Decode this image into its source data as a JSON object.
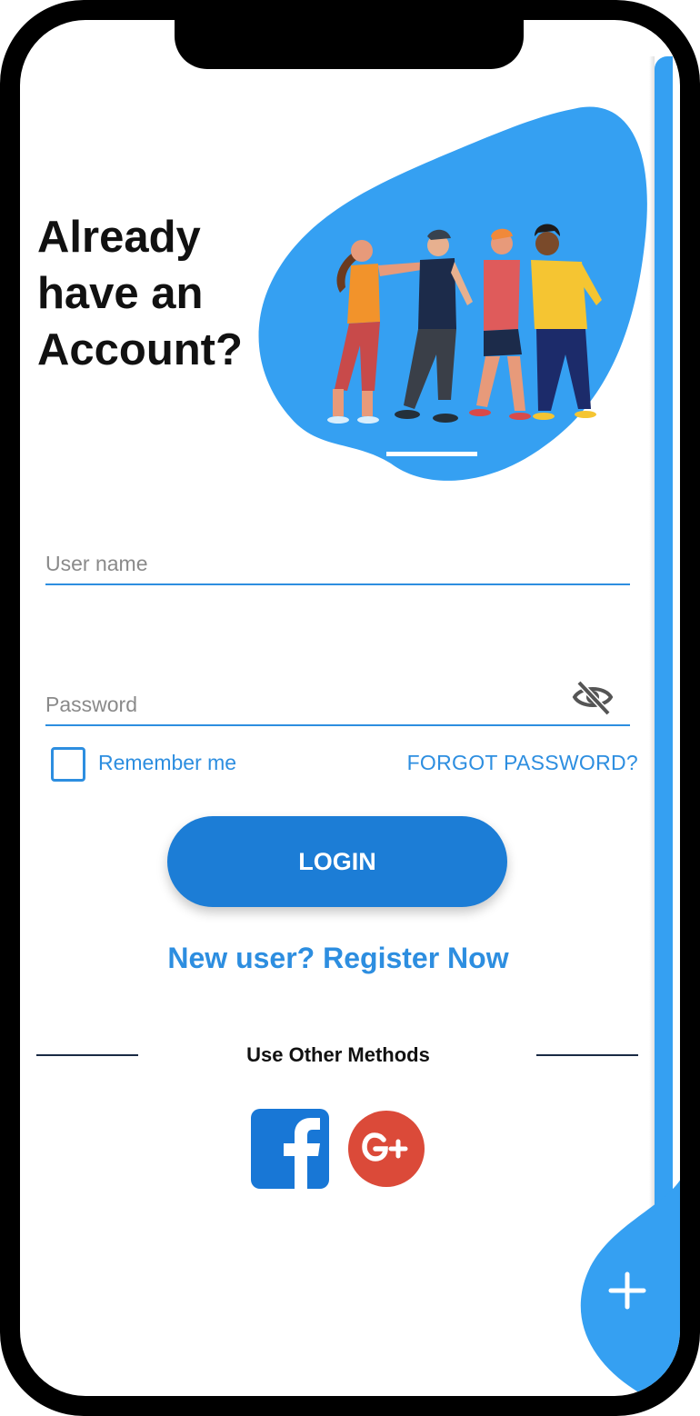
{
  "login_screen": {
    "heading": "Already\nhave an\nAccount?",
    "username": {
      "placeholder": "User name",
      "value": ""
    },
    "password": {
      "placeholder": "Password",
      "value": ""
    },
    "remember_me_label": "Remember me",
    "remember_me_checked": false,
    "forgot_password_label": "FORGOT PASSWORD?",
    "login_button_label": "LOGIN",
    "register_link_label": "New user? Register Now",
    "other_methods_label": "Use Other Methods"
  },
  "icons": {
    "eye": "eye-slash-icon",
    "facebook": "facebook-icon",
    "google_plus": "google-plus-icon",
    "plus": "plus-icon"
  },
  "colors": {
    "accent": "#2d8ee0",
    "button": "#1c7dd6",
    "blob": "#35a0f2",
    "facebook": "#1877d6",
    "google": "#db4a39"
  }
}
